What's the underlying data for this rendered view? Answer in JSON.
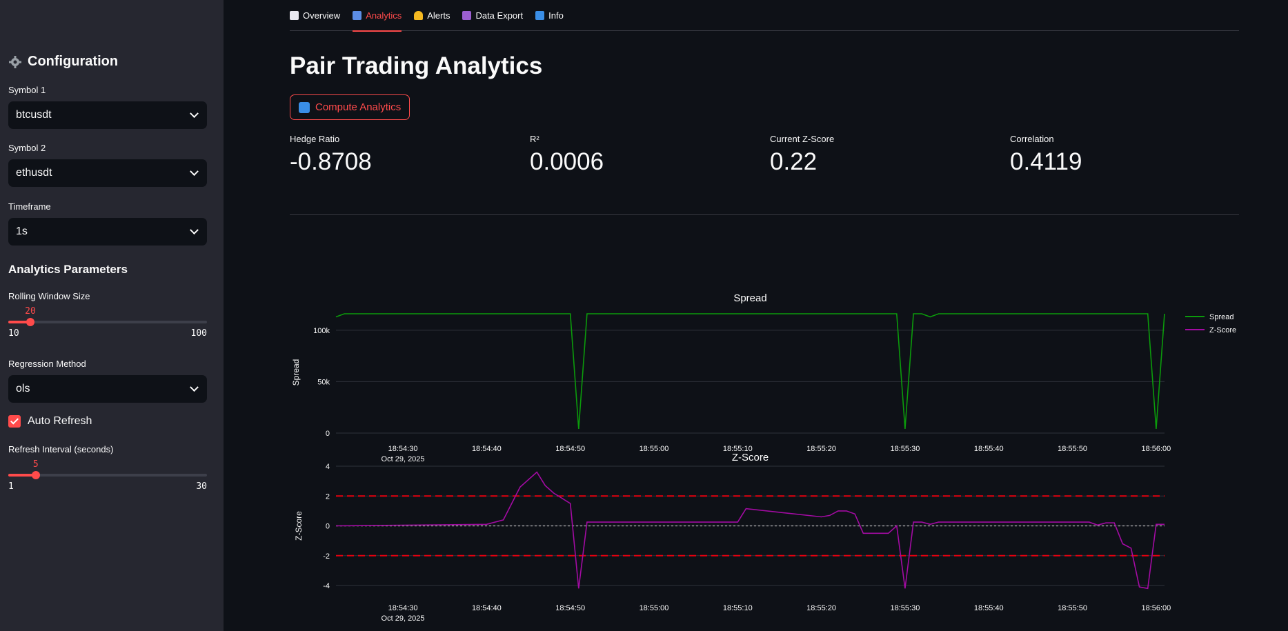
{
  "sidebar": {
    "title": "Configuration",
    "symbol1": {
      "label": "Symbol 1",
      "value": "btcusdt"
    },
    "symbol2": {
      "label": "Symbol 2",
      "value": "ethusdt"
    },
    "timeframe": {
      "label": "Timeframe",
      "value": "1s"
    },
    "analytics_heading": "Analytics Parameters",
    "rolling_window": {
      "label": "Rolling Window Size",
      "value": "20",
      "min": "10",
      "max": "100",
      "fraction": 0.111
    },
    "regression": {
      "label": "Regression Method",
      "value": "ols"
    },
    "auto_refresh": {
      "label": "Auto Refresh",
      "checked": true
    },
    "refresh_interval": {
      "label": "Refresh Interval (seconds)",
      "value": "5",
      "min": "1",
      "max": "30",
      "fraction": 0.138
    }
  },
  "tabs": [
    {
      "label": "Overview",
      "icon": "chart-increasing-icon",
      "active": false
    },
    {
      "label": "Analytics",
      "icon": "bar-chart-icon",
      "active": true
    },
    {
      "label": "Alerts",
      "icon": "bell-icon",
      "active": false
    },
    {
      "label": "Data Export",
      "icon": "floppy-disk-icon",
      "active": false
    },
    {
      "label": "Info",
      "icon": "info-icon",
      "active": false
    }
  ],
  "main": {
    "title": "Pair Trading Analytics",
    "compute_button": "Compute Analytics",
    "metrics": [
      {
        "label": "Hedge Ratio",
        "value": "-0.8708"
      },
      {
        "label": "R²",
        "value": "0.0006"
      },
      {
        "label": "Current Z-Score",
        "value": "0.22"
      },
      {
        "label": "Correlation",
        "value": "0.4119"
      }
    ]
  },
  "colors": {
    "accent": "#ff4b4b",
    "spread": "#0b9b0b",
    "zscore": "#a30ba3",
    "threshold": "#e3000f"
  },
  "chart_data": [
    {
      "type": "line",
      "title": "Spread",
      "ylabel": "Spread",
      "xlabel": "",
      "date_label": "Oct 29, 2025",
      "x_ticks": [
        "18:54:30",
        "18:54:40",
        "18:54:50",
        "18:55:00",
        "18:55:10",
        "18:55:20",
        "18:55:30",
        "18:55:40",
        "18:55:50",
        "18:56:00"
      ],
      "y_ticks": [
        "0",
        "50k",
        "100k"
      ],
      "ylim": [
        0,
        118000
      ],
      "xlim": [
        "18:54:22",
        "18:56:01"
      ],
      "legend": {
        "placement": "top-right",
        "entries": [
          "Spread",
          "Z-Score"
        ]
      },
      "series": [
        {
          "name": "Spread",
          "x": [
            "18:54:22",
            "18:54:23",
            "18:54:50",
            "18:54:51",
            "18:54:52",
            "18:55:29",
            "18:55:30",
            "18:55:31",
            "18:55:32",
            "18:55:33",
            "18:55:34",
            "18:55:35",
            "18:55:59",
            "18:56:00",
            "18:56:01"
          ],
          "values": [
            113000,
            116000,
            116000,
            4000,
            116000,
            116000,
            4000,
            116000,
            116000,
            113000,
            116000,
            116000,
            116000,
            4000,
            116000
          ]
        }
      ]
    },
    {
      "type": "line",
      "title": "Z-Score",
      "ylabel": "Z-Score",
      "xlabel": "",
      "date_label": "Oct 29, 2025",
      "x_ticks": [
        "18:54:30",
        "18:54:40",
        "18:54:50",
        "18:55:00",
        "18:55:10",
        "18:55:20",
        "18:55:30",
        "18:55:40",
        "18:55:50",
        "18:56:00"
      ],
      "y_ticks": [
        "-4",
        "-2",
        "0",
        "2",
        "4"
      ],
      "ylim": [
        -4,
        4
      ],
      "xlim": [
        "18:54:22",
        "18:56:01"
      ],
      "thresholds": [
        2,
        -2
      ],
      "zero_line": 0,
      "series": [
        {
          "name": "Z-Score",
          "x": [
            "18:54:22",
            "18:54:40",
            "18:54:42",
            "18:54:44",
            "18:54:46",
            "18:54:47",
            "18:54:48",
            "18:54:50",
            "18:54:51",
            "18:54:52",
            "18:55:10",
            "18:55:11",
            "18:55:20",
            "18:55:21",
            "18:55:22",
            "18:55:23",
            "18:55:24",
            "18:55:25",
            "18:55:26",
            "18:55:28",
            "18:55:29",
            "18:55:30",
            "18:55:31",
            "18:55:32",
            "18:55:33",
            "18:55:34",
            "18:55:35",
            "18:55:52",
            "18:55:53",
            "18:55:54",
            "18:55:55",
            "18:55:56",
            "18:55:57",
            "18:55:58",
            "18:55:59",
            "18:56:00",
            "18:56:01"
          ],
          "values": [
            0,
            0.1,
            0.4,
            2.6,
            3.6,
            2.7,
            2.2,
            1.5,
            -4.2,
            0.25,
            0.25,
            1.15,
            0.6,
            0.7,
            1.0,
            1.0,
            0.8,
            -0.5,
            -0.5,
            -0.5,
            0,
            -4.2,
            0.25,
            0.25,
            0.1,
            0.25,
            0.25,
            0.25,
            0.05,
            0.2,
            0.2,
            -1.2,
            -1.5,
            -4.1,
            -4.2,
            0.1,
            0.1
          ]
        }
      ]
    }
  ]
}
